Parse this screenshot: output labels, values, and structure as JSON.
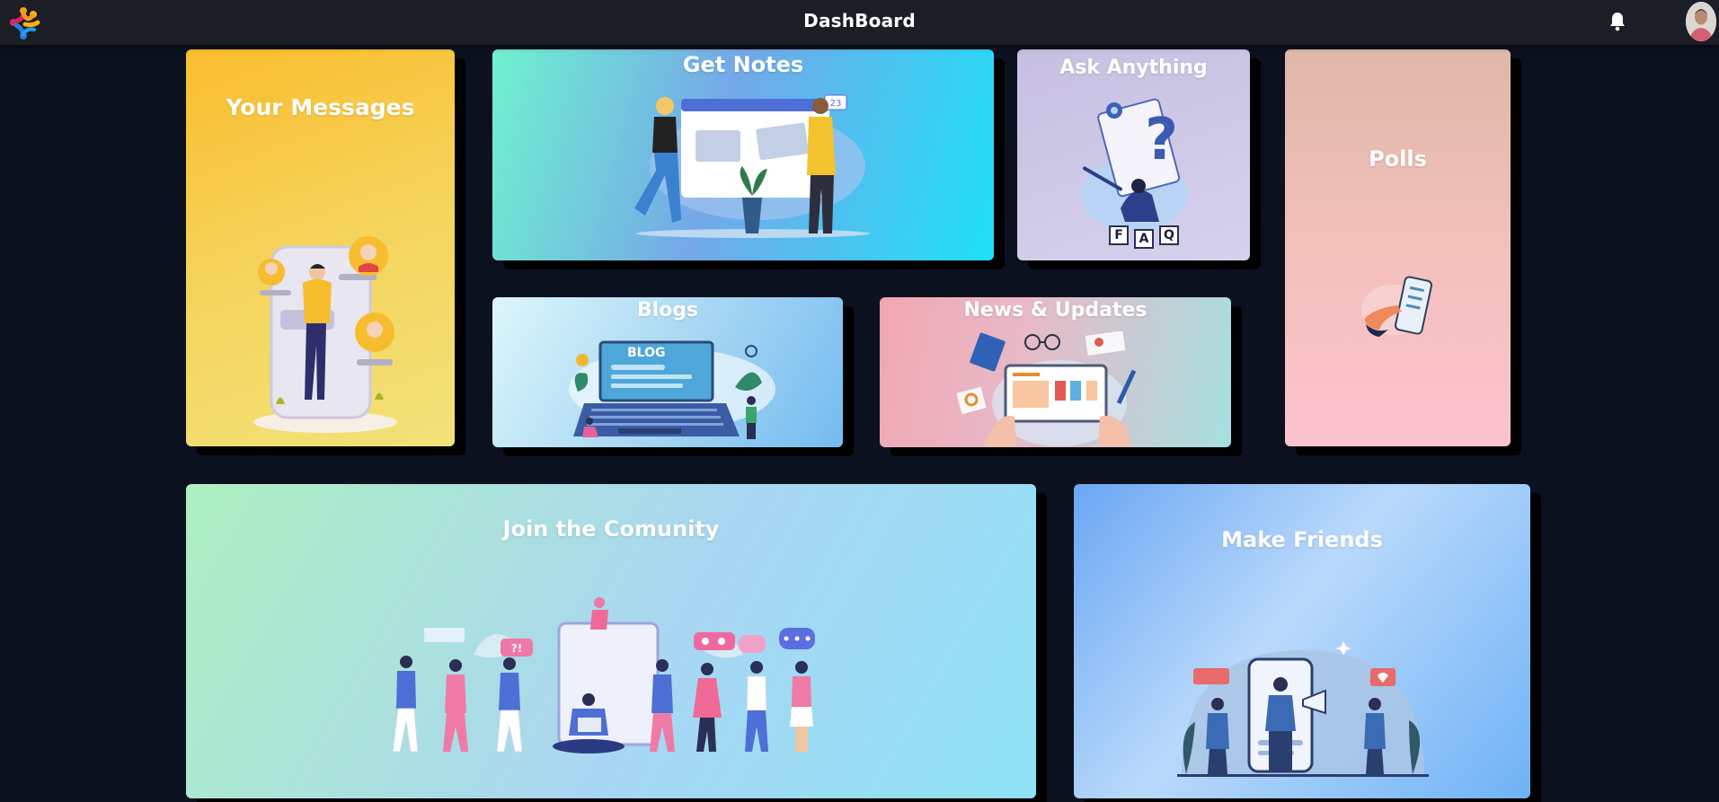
{
  "header": {
    "title": "DashBoard"
  },
  "cards": {
    "messages": {
      "title": "Your Messages"
    },
    "notes": {
      "title": "Get Notes",
      "badge": "23"
    },
    "ask": {
      "title": "Ask Anything",
      "faq_letters": [
        "F",
        "A",
        "Q"
      ]
    },
    "polls": {
      "title": "Polls"
    },
    "blogs": {
      "title": "Blogs",
      "screen_text": "BLOG"
    },
    "news": {
      "title": "News & Updates"
    },
    "community": {
      "title": "Join the Comunity",
      "bubble_text": "?!"
    },
    "friends": {
      "title": "Make Friends"
    }
  },
  "icons": {
    "logo": "app-logo",
    "bell": "bell-icon",
    "avatar": "user-avatar"
  },
  "colors": {
    "topbar": "#1b1e25",
    "background": "#0c1120",
    "title_text": "#ffffff"
  }
}
